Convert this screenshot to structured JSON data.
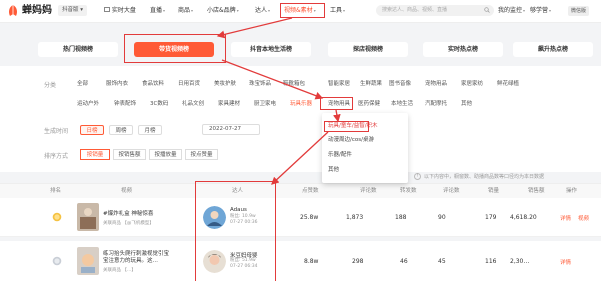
{
  "app": {
    "name": "蝉妈妈",
    "platform": "抖音版",
    "platform_caret": "▾"
  },
  "nav": {
    "items": [
      {
        "label": "实时大盘",
        "icon": "live-screen-icon"
      },
      {
        "label": "直播",
        "caret": "▾"
      },
      {
        "label": "商品",
        "caret": "▾"
      },
      {
        "label": "小店&品牌",
        "caret": "▾"
      },
      {
        "label": "达人",
        "caret": "▾"
      },
      {
        "label": "视频&素材",
        "caret": "▾",
        "highlighted": true
      },
      {
        "label": "工具",
        "caret": "▾"
      },
      {
        "label": "我的监控",
        "caret": "▾"
      },
      {
        "label": "够学营",
        "caret": "▾"
      }
    ],
    "search_placeholder": "搜索达人、商品、视频、直播",
    "user_label": "微信版"
  },
  "rank_tabs": [
    {
      "label": "热门视频榜",
      "active": false
    },
    {
      "label": "带货视频榜",
      "active": true
    },
    {
      "label": "抖音本地生活榜",
      "active": false
    },
    {
      "label": "探店视频榜",
      "active": false
    },
    {
      "label": "实时热点榜",
      "active": false
    },
    {
      "label": "飙升热点榜",
      "active": false
    }
  ],
  "filters": {
    "category_label": "分类",
    "categories_row1": [
      "全部",
      "服饰内衣",
      "食品饮料",
      "日用百货",
      "美妆护肤",
      "珠宝饰品",
      "鞋靴箱包",
      "智能家居",
      "生鲜蔬果",
      "图书音像",
      "宠物用品",
      "家居家纺",
      "鲜花绿植"
    ],
    "categories_row2": [
      "运动户外",
      "钟表配饰",
      "3C数码",
      "礼品文创",
      "家具建材",
      "厨卫家电",
      "玩具乐器",
      "宠物用具",
      "医药保健",
      "本地生活",
      "汽配摩托",
      "其他"
    ],
    "active_category": "玩具乐器",
    "time_label": "生成时间",
    "time_options": [
      {
        "label": "日榜",
        "active": true
      },
      {
        "label": "周榜",
        "active": false
      },
      {
        "label": "月榜",
        "active": false
      }
    ],
    "date_value": "2022-07-27",
    "sort_label": "排序方式",
    "sort_options": [
      {
        "label": "按销量",
        "active": true
      },
      {
        "label": "按销售额",
        "active": false
      },
      {
        "label": "按播放量",
        "active": false
      },
      {
        "label": "按点赞量",
        "active": false
      }
    ],
    "tip": "以下内容中，橱窗数、助播商品数等口径均为本日数据"
  },
  "dropdown": {
    "items": [
      "玩具/童车/益智/积木",
      "动漫周边/cos/桌游",
      "乐器/配件",
      "其他"
    ],
    "highlighted_index": 0
  },
  "table": {
    "headers": [
      "排名",
      "视频",
      "达人",
      "点赞数",
      "评论数",
      "转发数",
      "评论数",
      "销量",
      "销售额",
      "操作"
    ],
    "rows": [
      {
        "rank_icon": "gold-medal-icon",
        "title": "#爆炸礼盒 神秘惊喜",
        "meta": "关联商品 【@飞机模型】",
        "talent_name": "Adaus",
        "talent_meta1": "粉丝: 10.9w",
        "talent_meta2": "07-27 00:36",
        "likes": "25.8w",
        "comments": "1,873",
        "shares": "188",
        "col4": "90",
        "sales": "179",
        "revenue": "4,618.20",
        "actions": [
          "详情",
          "视频"
        ]
      },
      {
        "rank_icon": "silver-medal-icon",
        "title": "练习抬头爬行刺激视觉引宝宝注意力的玩具。这…",
        "meta": "关联商品 【…】",
        "talent_name": "米豆妈母婴",
        "talent_meta1": "粉丝: 51.9w",
        "talent_meta2": "07-27 06:34",
        "likes": "8.8w",
        "comments": "298",
        "shares": "46",
        "col4": "45",
        "sales": "116",
        "revenue": "2,30…",
        "actions": [
          "详情"
        ]
      }
    ]
  },
  "colors": {
    "accent": "#ff5a36",
    "annotation_red": "#e23b3b"
  }
}
